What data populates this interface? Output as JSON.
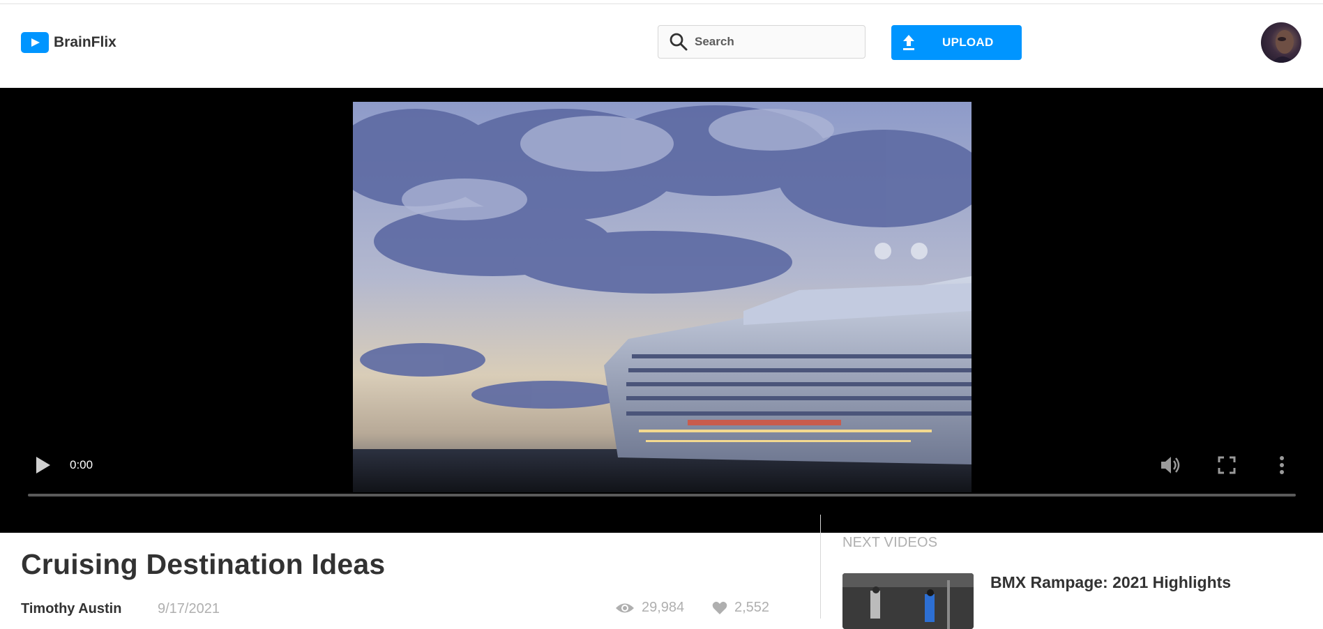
{
  "header": {
    "brand_name": "BrainFlix",
    "search_placeholder": "Search",
    "upload_label": "UPLOAD"
  },
  "player": {
    "current_time": "0:00"
  },
  "video": {
    "title": "Cruising Destination Ideas",
    "author": "Timothy Austin",
    "date": "9/17/2021",
    "views": "29,984",
    "likes": "2,552"
  },
  "sidebar": {
    "heading": "NEXT VIDEOS",
    "items": [
      {
        "title": "BMX Rampage: 2021 Highlights"
      }
    ]
  },
  "colors": {
    "brand_blue": "#0095ff",
    "text_dark": "#323232",
    "text_muted": "#afafaf"
  }
}
